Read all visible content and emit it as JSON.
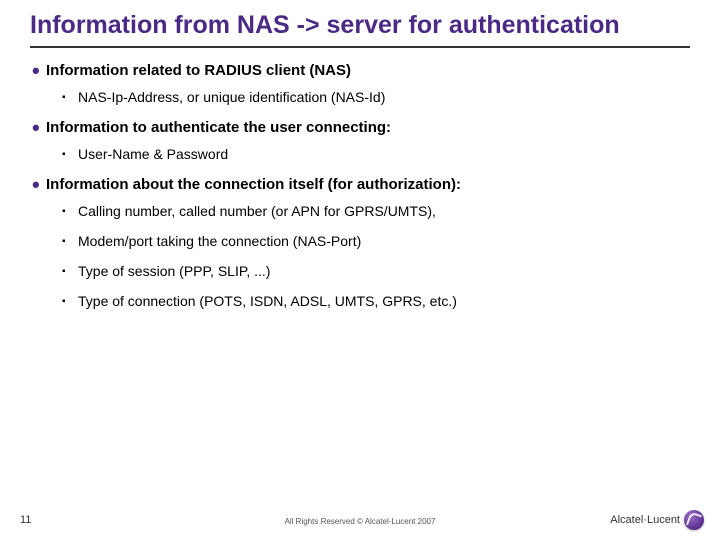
{
  "title": "Information from NAS -> server for authentication",
  "bullets": {
    "a": {
      "label": "Information related to RADIUS client (NAS)",
      "sub": {
        "a1": "NAS-Ip-Address, or unique identification (NAS-Id)"
      }
    },
    "b": {
      "label": "Information to authenticate the user connecting:",
      "sub": {
        "b1": "User-Name & Password"
      }
    },
    "c": {
      "label": "Information about the connection itself (for authorization):",
      "sub": {
        "c1": "Calling number, called number (or APN for GPRS/UMTS),",
        "c2": "Modem/port taking the connection (NAS-Port)",
        "c3": "Type of session (PPP, SLIP, ...)",
        "c4": "Type of connection (POTS, ISDN, ADSL, UMTS, GPRS, etc.)"
      }
    }
  },
  "footer": {
    "page": "11",
    "copyright": "All Rights Reserved © Alcatel-Lucent 2007",
    "brand": "Alcatel·Lucent"
  }
}
